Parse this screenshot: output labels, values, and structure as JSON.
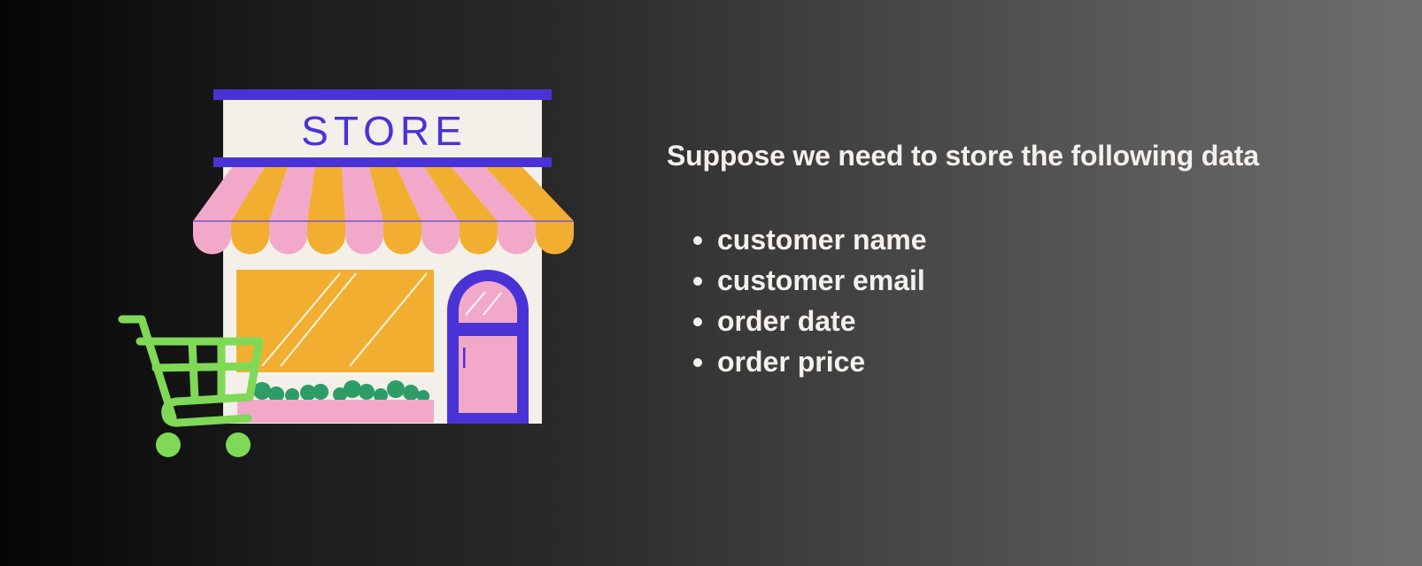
{
  "illustration": {
    "sign_text": "STORE",
    "colors": {
      "purple": "#4a33d6",
      "cream": "#f3f0ea",
      "orange": "#f2ae30",
      "pink": "#f2a9c9",
      "green_cart": "#7fd957",
      "green_bush": "#2c9d67"
    }
  },
  "content": {
    "heading": "Suppose we need to store the following data",
    "items": [
      "customer name",
      "customer email",
      "order date",
      "order price"
    ]
  }
}
